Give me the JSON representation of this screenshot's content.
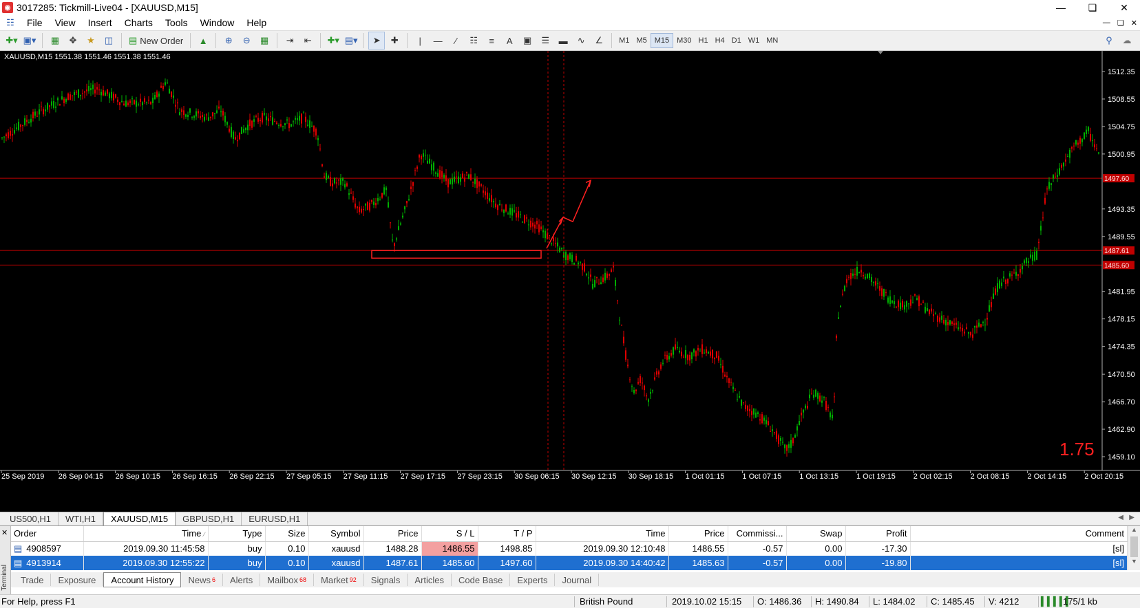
{
  "window": {
    "title": "3017285: Tickmill-Live04 - [XAUUSD,M15]"
  },
  "menu": [
    "File",
    "View",
    "Insert",
    "Charts",
    "Tools",
    "Window",
    "Help"
  ],
  "toolbar": {
    "new_order": "New Order",
    "text_tool": "A",
    "timeframes": [
      "M1",
      "M5",
      "M15",
      "M30",
      "H1",
      "H4",
      "D1",
      "W1",
      "MN"
    ],
    "active_timeframe": "M15"
  },
  "chart": {
    "info": "XAUUSD,M15  1551.38 1551.46 1551.38 1551.46",
    "price_labels": [
      "1512.35",
      "1508.55",
      "1504.75",
      "1500.95",
      "1493.35",
      "1489.55",
      "1481.95",
      "1478.15",
      "1474.35",
      "1470.50",
      "1466.70",
      "1462.90",
      "1459.10"
    ],
    "hline_labels": [
      "1497.60",
      "1487.61",
      "1485.60"
    ],
    "time_labels": [
      "25 Sep 2019",
      "26 Sep 04:15",
      "26 Sep 10:15",
      "26 Sep 16:15",
      "26 Sep 22:15",
      "27 Sep 05:15",
      "27 Sep 11:15",
      "27 Sep 17:15",
      "27 Sep 23:15",
      "30 Sep 06:15",
      "30 Sep 12:15",
      "30 Sep 18:15",
      "1 Oct 01:15",
      "1 Oct 07:15",
      "1 Oct 13:15",
      "1 Oct 19:15",
      "2 Oct 02:15",
      "2 Oct 08:15",
      "2 Oct 14:15",
      "2 Oct 20:15"
    ],
    "overlay_value": "1.75",
    "colors": {
      "background": "#000000",
      "bull": "#00b000",
      "bear": "#e00000",
      "hline": "#c00000",
      "overlay": "#ff2020"
    }
  },
  "symbol_tabs": [
    "US500,H1",
    "WTI,H1",
    "XAUUSD,M15",
    "GBPUSD,H1",
    "EURUSD,H1"
  ],
  "active_symbol_tab": "XAUUSD,M15",
  "terminal": {
    "side_label": "Terminal",
    "columns": [
      "Order",
      "Time",
      "Type",
      "Size",
      "Symbol",
      "Price",
      "S / L",
      "T / P",
      "Time",
      "Price",
      "Commissi...",
      "Swap",
      "Profit",
      "Comment"
    ],
    "rows": [
      {
        "order": "4908597",
        "open_time": "2019.09.30 11:45:58",
        "type": "buy",
        "size": "0.10",
        "symbol": "xauusd",
        "price": "1488.28",
        "sl": "1486.55",
        "tp": "1498.85",
        "close_time": "2019.09.30 12:10:48",
        "close_price": "1486.55",
        "commission": "-0.57",
        "swap": "0.00",
        "profit": "-17.30",
        "comment": "[sl]"
      },
      {
        "order": "4913914",
        "open_time": "2019.09.30 12:55:22",
        "type": "buy",
        "size": "0.10",
        "symbol": "xauusd",
        "price": "1487.61",
        "sl": "1485.60",
        "tp": "1497.60",
        "close_time": "2019.09.30 14:40:42",
        "close_price": "1485.63",
        "commission": "-0.57",
        "swap": "0.00",
        "profit": "-19.80",
        "comment": "[sl]"
      }
    ],
    "tabs": [
      {
        "label": "Trade",
        "badge": ""
      },
      {
        "label": "Exposure",
        "badge": ""
      },
      {
        "label": "Account History",
        "badge": ""
      },
      {
        "label": "News",
        "badge": "6"
      },
      {
        "label": "Alerts",
        "badge": ""
      },
      {
        "label": "Mailbox",
        "badge": "68"
      },
      {
        "label": "Market",
        "badge": "92"
      },
      {
        "label": "Signals",
        "badge": ""
      },
      {
        "label": "Articles",
        "badge": ""
      },
      {
        "label": "Code Base",
        "badge": ""
      },
      {
        "label": "Experts",
        "badge": ""
      },
      {
        "label": "Journal",
        "badge": ""
      }
    ],
    "active_tab": "Account History"
  },
  "status": {
    "help": "For Help, press F1",
    "profile": "British Pound",
    "datetime": "2019.10.02 15:15",
    "open": "O: 1486.36",
    "high": "H: 1490.84",
    "low": "L: 1484.02",
    "close": "C: 1485.45",
    "volume": "V: 4212",
    "traffic": "175/1 kb"
  }
}
